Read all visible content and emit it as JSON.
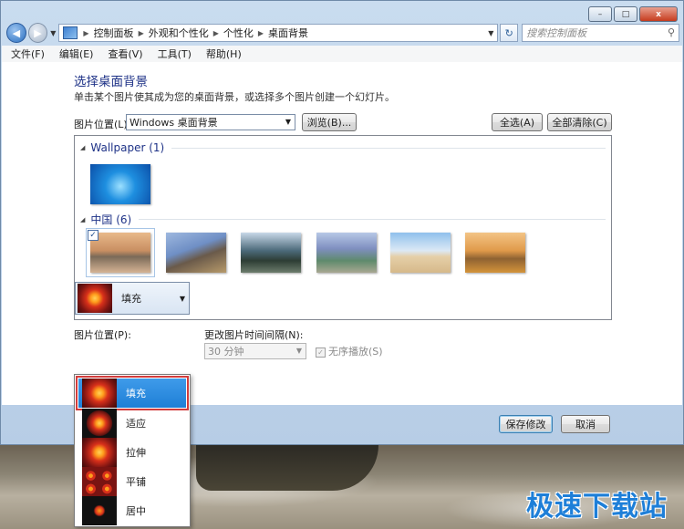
{
  "window": {
    "buttons": {
      "minimize": "–",
      "maximize": "□",
      "close": "x"
    }
  },
  "nav": {
    "back": "◀",
    "forward": "▶",
    "breadcrumb": [
      "控制面板",
      "外观和个性化",
      "个性化",
      "桌面背景"
    ],
    "refresh": "↻",
    "search_placeholder": "搜索控制面板"
  },
  "menu": [
    "文件(F)",
    "编辑(E)",
    "查看(V)",
    "工具(T)",
    "帮助(H)"
  ],
  "page": {
    "title": "选择桌面背景",
    "subtitle": "单击某个图片使其成为您的桌面背景，或选择多个图片创建一个幻灯片。",
    "location_label": "图片位置(L):",
    "location_value": "Windows 桌面背景",
    "browse": "浏览(B)...",
    "select_all": "全选(A)",
    "clear_all": "全部清除(C)"
  },
  "gallery": {
    "groups": [
      {
        "name": "Wallpaper (1)",
        "items": [
          "win7"
        ]
      },
      {
        "name": "中国 (6)",
        "items": [
          "guilin",
          "great-wall",
          "karst",
          "river",
          "desert",
          "bridge"
        ]
      }
    ],
    "checked_mark": "✓"
  },
  "position": {
    "label": "图片位置(P):",
    "selected": "填充",
    "options": [
      "填充",
      "适应",
      "拉伸",
      "平铺",
      "居中"
    ]
  },
  "interval": {
    "label": "更改图片时间间隔(N):",
    "value": "30 分钟",
    "shuffle_label": "无序播放(S)"
  },
  "footer": {
    "save": "保存修改",
    "cancel": "取消"
  },
  "watermark": "极速下载站"
}
